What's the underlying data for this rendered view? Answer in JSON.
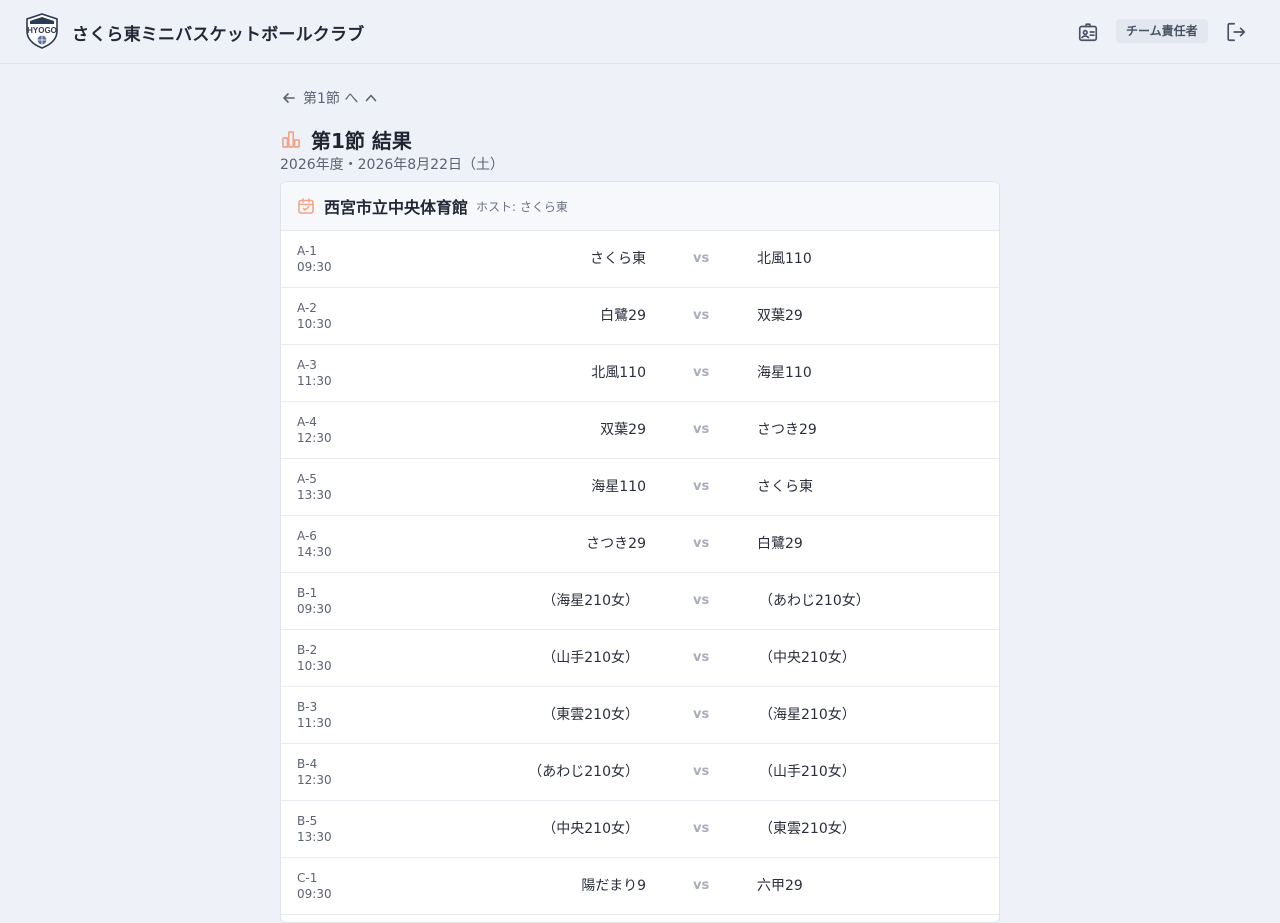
{
  "header": {
    "logo_text": "HYOGO",
    "app_title": "さくら東ミニバスケットボールクラブ",
    "role_badge": "チーム責任者"
  },
  "nav": {
    "back_label": "第1節 へ"
  },
  "page": {
    "title": "第1節 結果",
    "subtitle": "2026年度・2026年8月22日（土）"
  },
  "venue": {
    "name": "西宮市立中央体育館",
    "host": "ホスト: さくら東"
  },
  "vs_label": "vs",
  "matches": [
    {
      "id": "A-1",
      "time": "09:30",
      "home": "さくら東",
      "away": "北風110",
      "sub": false
    },
    {
      "id": "A-2",
      "time": "10:30",
      "home": "白鷺29",
      "away": "双葉29",
      "sub": false
    },
    {
      "id": "A-3",
      "time": "11:30",
      "home": "北風110",
      "away": "海星110",
      "sub": false
    },
    {
      "id": "A-4",
      "time": "12:30",
      "home": "双葉29",
      "away": "さつき29",
      "sub": false
    },
    {
      "id": "A-5",
      "time": "13:30",
      "home": "海星110",
      "away": "さくら東",
      "sub": false
    },
    {
      "id": "A-6",
      "time": "14:30",
      "home": "さつき29",
      "away": "白鷺29",
      "sub": false
    },
    {
      "id": "B-1",
      "time": "09:30",
      "home": "（海星210女）",
      "away": "（あわじ210女）",
      "sub": true
    },
    {
      "id": "B-2",
      "time": "10:30",
      "home": "（山手210女）",
      "away": "（中央210女）",
      "sub": true
    },
    {
      "id": "B-3",
      "time": "11:30",
      "home": "（東雲210女）",
      "away": "（海星210女）",
      "sub": true
    },
    {
      "id": "B-4",
      "time": "12:30",
      "home": "（あわじ210女）",
      "away": "（山手210女）",
      "sub": true
    },
    {
      "id": "B-5",
      "time": "13:30",
      "home": "（中央210女）",
      "away": "（東雲210女）",
      "sub": true
    },
    {
      "id": "C-1",
      "time": "09:30",
      "home": "陽だまり9",
      "away": "六甲29",
      "sub": false
    }
  ],
  "colors": {
    "background": "#eef1f8",
    "accent": "#f0a589",
    "card": "#ffffff",
    "vs": "#a9aebb"
  },
  "icons": {
    "logo": "hyogo-emblem-icon",
    "id_card": "id-card-icon",
    "logout": "logout-icon",
    "back": "arrow-left-icon",
    "up": "chevron-up-icon",
    "title": "bar-chart-icon",
    "venue": "calendar-icon"
  }
}
